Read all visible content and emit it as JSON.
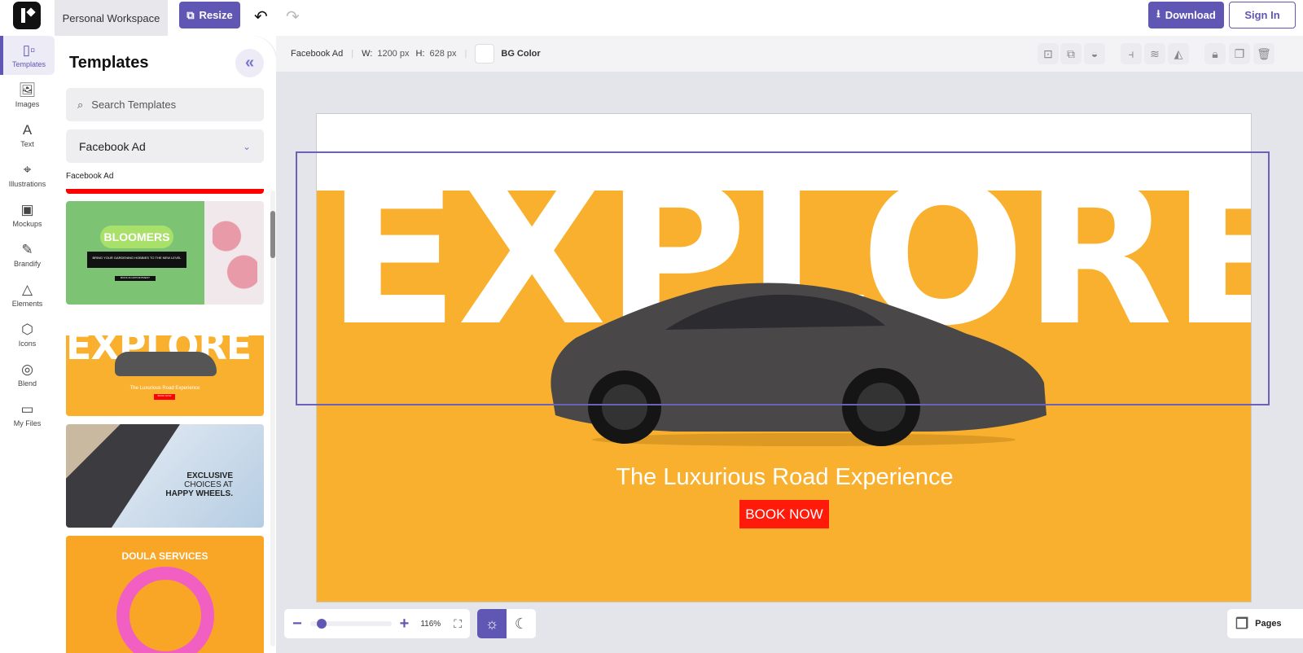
{
  "header": {
    "workspace": "Personal Workspace",
    "resize_label": "Resize",
    "download_label": "Download",
    "signin_label": "Sign In"
  },
  "rail": [
    {
      "label": "Templates",
      "icon": "▯▫"
    },
    {
      "label": "Images",
      "icon": "🖼"
    },
    {
      "label": "Text",
      "icon": "A"
    },
    {
      "label": "Illustrations",
      "icon": "⌖"
    },
    {
      "label": "Mockups",
      "icon": "▣"
    },
    {
      "label": "Brandify",
      "icon": "✎"
    },
    {
      "label": "Elements",
      "icon": "△"
    },
    {
      "label": "Icons",
      "icon": "⬡"
    },
    {
      "label": "Blend",
      "icon": "◎"
    },
    {
      "label": "My Files",
      "icon": "▭"
    }
  ],
  "panel": {
    "title": "Templates",
    "search_placeholder": "Search Templates",
    "category": "Facebook Ad",
    "section_label": "Facebook Ad",
    "templates": [
      {
        "title": "BLOOMERS",
        "subtitle": "BRING YOUR GARDENING HOBBIES TO THE NEW LEVEL",
        "cta": "BOOK AN APPOINTMENT"
      },
      {
        "title": "EXPLORE",
        "subtitle": "The Luxurious Road Experience",
        "cta": "BOOK NOW"
      },
      {
        "title_1": "EXCLUSIVE",
        "title_2": "CHOICES AT",
        "title_3": "HAPPY WHEELS."
      },
      {
        "title": "DOULA SERVICES"
      }
    ]
  },
  "toolbar": {
    "format": "Facebook Ad",
    "w_label": "W:",
    "w_value": "1200 px",
    "h_label": "H:",
    "h_value": "628 px",
    "bg_label": "BG Color"
  },
  "canvas": {
    "headline": "EXPLORE",
    "tagline": "The Luxurious Road Experience",
    "button": "BOOK NOW"
  },
  "zoom": {
    "value": "116%",
    "slider_fraction": 0.1
  },
  "pages_label": "Pages",
  "colors": {
    "accent": "#5f57b3",
    "ad_orange": "#f9b02e",
    "cta_red": "#ff1a0a"
  }
}
